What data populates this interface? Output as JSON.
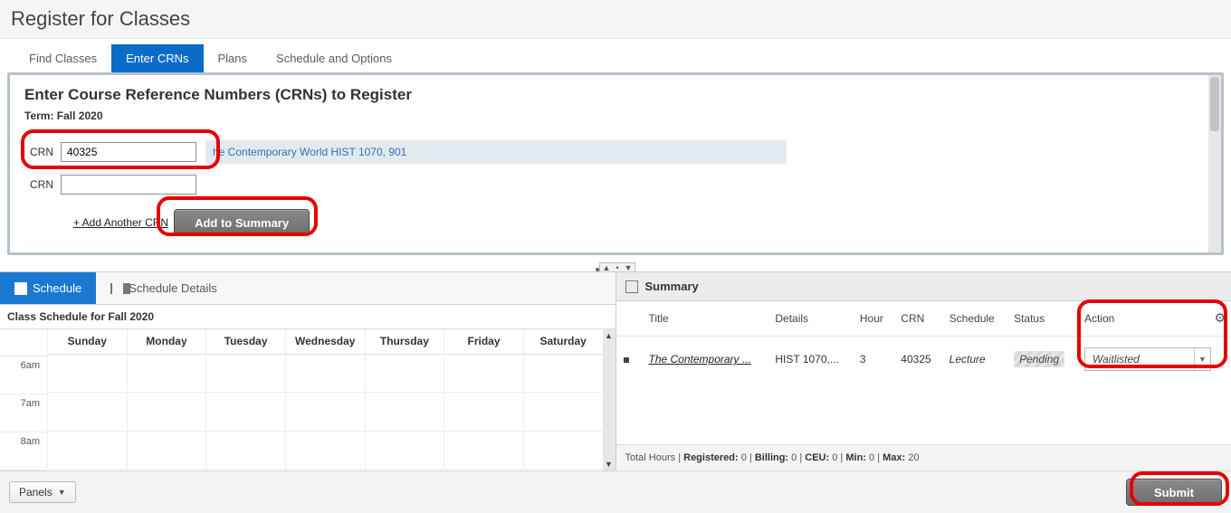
{
  "page": {
    "title": "Register for Classes"
  },
  "tabs": {
    "items": [
      "Find Classes",
      "Enter CRNs",
      "Plans",
      "Schedule and Options"
    ],
    "active_index": 1
  },
  "panel": {
    "heading": "Enter Course Reference Numbers (CRNs) to Register",
    "term_prefix": "Term: ",
    "term": "Fall 2020"
  },
  "crn": {
    "label": "CRN",
    "rows": [
      {
        "value": "40325",
        "desc": "he Contemporary World HIST 1070, 901"
      },
      {
        "value": "",
        "desc": ""
      }
    ],
    "add_another": "+ Add Another CRN",
    "add_to_summary": "Add to Summary"
  },
  "schedule": {
    "tab_schedule": "Schedule",
    "tab_details": "Schedule Details",
    "title_prefix": "Class Schedule for ",
    "title_term": "Fall 2020",
    "days": [
      "Sunday",
      "Monday",
      "Tuesday",
      "Wednesday",
      "Thursday",
      "Friday",
      "Saturday"
    ],
    "hours": [
      "6am",
      "7am",
      "8am"
    ]
  },
  "summary": {
    "header": "Summary",
    "cols": {
      "title": "Title",
      "details": "Details",
      "hours": "Hour",
      "crn": "CRN",
      "schedule": "Schedule",
      "status": "Status",
      "action": "Action"
    },
    "rows": [
      {
        "title": "The Contemporary ...",
        "details": "HIST 1070,...",
        "hours": "3",
        "crn": "40325",
        "schedule": "Lecture",
        "status": "Pending",
        "action": "Waitlisted"
      }
    ],
    "totals": {
      "label": "Total Hours",
      "registered_l": "Registered:",
      "registered_v": "0",
      "billing_l": "Billing:",
      "billing_v": "0",
      "ceu_l": "CEU:",
      "ceu_v": "0",
      "min_l": "Min:",
      "min_v": "0",
      "max_l": "Max:",
      "max_v": "20"
    }
  },
  "footer": {
    "panels": "Panels",
    "submit": "Submit"
  }
}
